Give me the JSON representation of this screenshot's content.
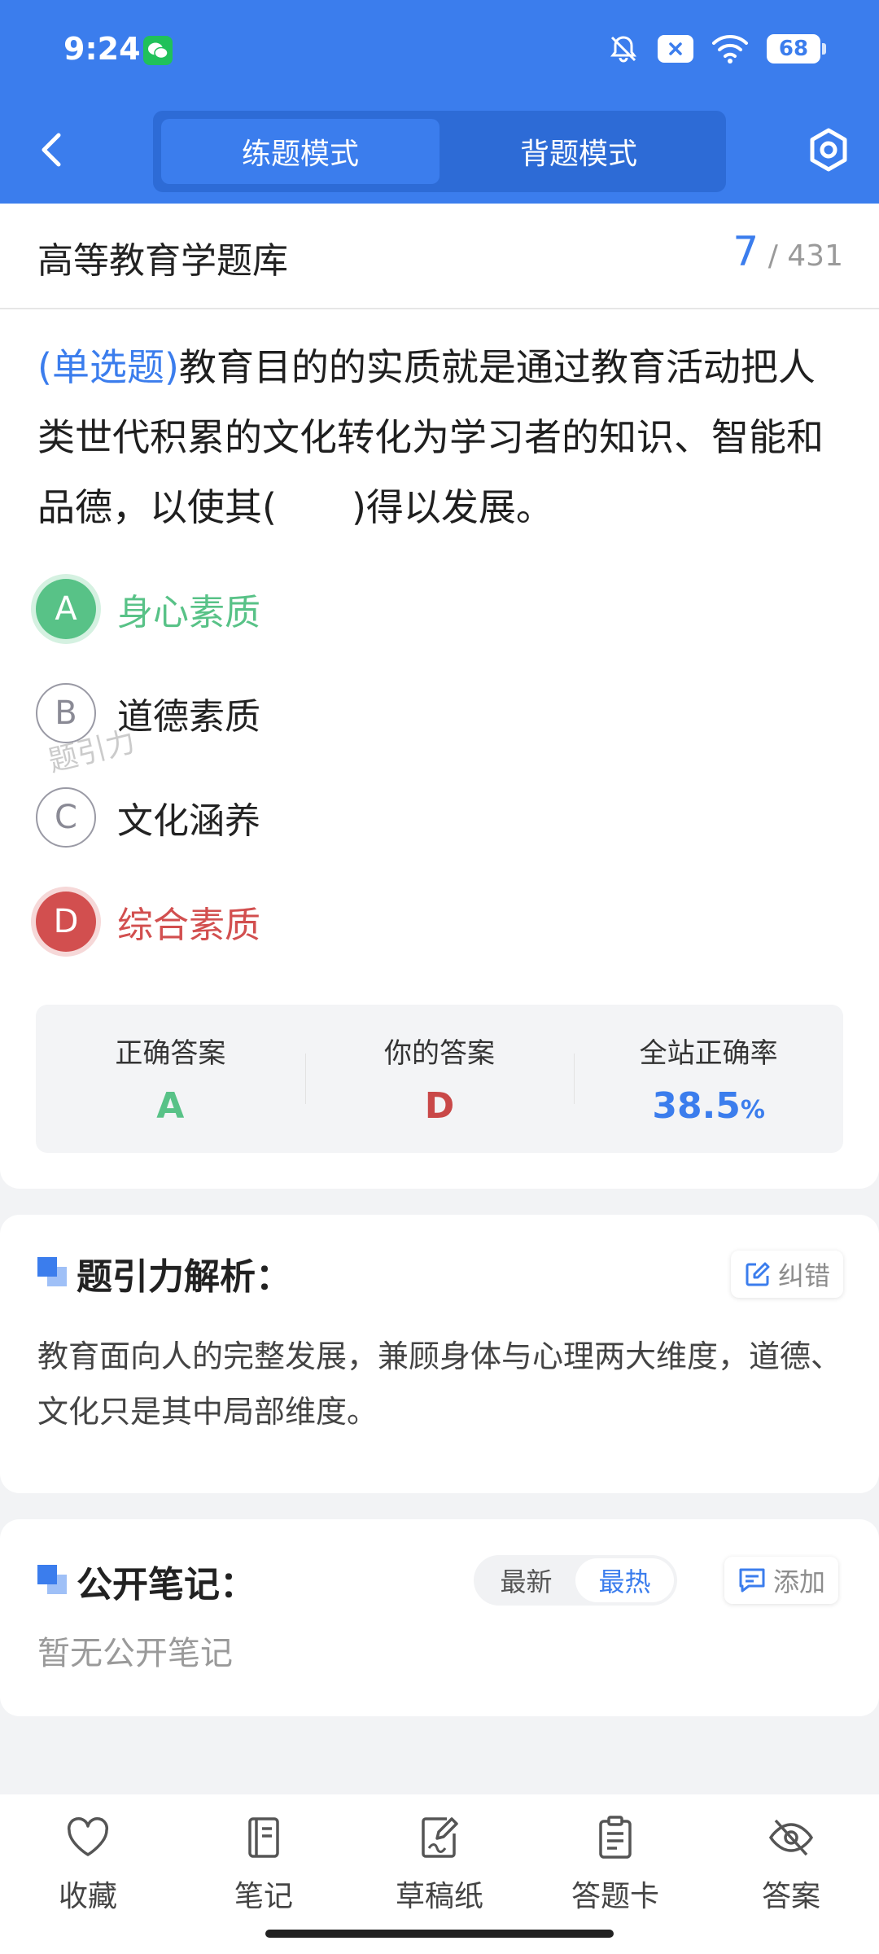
{
  "status_bar": {
    "time": "9:24",
    "battery": "68"
  },
  "header": {
    "tabs": [
      {
        "label": "练题模式",
        "active": true
      },
      {
        "label": "背题模式",
        "active": false
      }
    ]
  },
  "title_row": {
    "title": "高等教育学题库",
    "current": "7",
    "separator": "/",
    "total": "431"
  },
  "question": {
    "type": "(单选题)",
    "text": "教育目的的实质就是通过教育活动把人类世代积累的文化转化为学习者的知识、智能和品德，以使其(　　)得以发展。",
    "options": [
      {
        "letter": "A",
        "label": "身心素质",
        "state": "correct"
      },
      {
        "letter": "B",
        "label": "道德素质",
        "state": "normal"
      },
      {
        "letter": "C",
        "label": "文化涵养",
        "state": "normal"
      },
      {
        "letter": "D",
        "label": "综合素质",
        "state": "wrong"
      }
    ]
  },
  "stats": {
    "correct_label": "正确答案",
    "correct_value": "A",
    "yours_label": "你的答案",
    "yours_value": "D",
    "rate_label": "全站正确率",
    "rate_value": "38.5",
    "rate_unit": "%",
    "watermark": "题引力"
  },
  "analysis": {
    "title": "题引力解析：",
    "report_label": "纠错",
    "text": "教育面向人的完整发展，兼顾身体与心理两大维度，道德、文化只是其中局部维度。"
  },
  "notes": {
    "title": "公开笔记：",
    "sort_options": [
      {
        "label": "最新",
        "active": false
      },
      {
        "label": "最热",
        "active": true
      }
    ],
    "add_label": "添加",
    "empty_text": "暂无公开笔记"
  },
  "bottom_nav": {
    "items": [
      {
        "label": "收藏",
        "icon": "heart-icon"
      },
      {
        "label": "笔记",
        "icon": "notebook-icon"
      },
      {
        "label": "草稿纸",
        "icon": "draft-paper-icon"
      },
      {
        "label": "答题卡",
        "icon": "clipboard-icon"
      },
      {
        "label": "答案",
        "icon": "eye-off-icon"
      }
    ]
  },
  "colors": {
    "primary": "#3b7ded",
    "correct": "#58c287",
    "wrong": "#d24f4f"
  }
}
